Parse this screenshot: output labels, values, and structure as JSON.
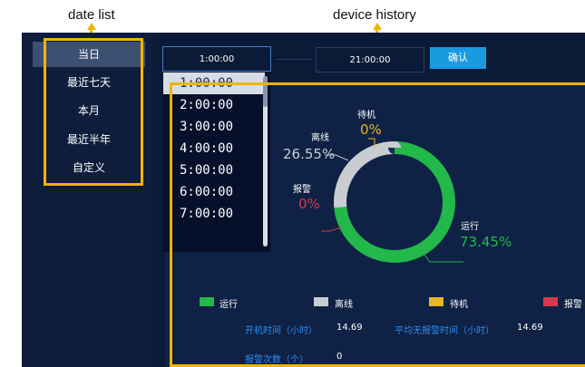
{
  "annotations": {
    "date_list": "date list",
    "device_history": "device history"
  },
  "sidebar": {
    "items": [
      {
        "label": "当日",
        "active": true
      },
      {
        "label": "最近七天"
      },
      {
        "label": "本月"
      },
      {
        "label": "最近半年"
      },
      {
        "label": "自定义"
      }
    ]
  },
  "toolbar": {
    "start_time": "1:00:00",
    "end_time": "21:00:00",
    "confirm_label": "确认"
  },
  "time_dropdown": {
    "options": [
      "1:00:00",
      "2:00:00",
      "3:00:00",
      "4:00:00",
      "5:00:00",
      "6:00:00",
      "7:00:00"
    ],
    "selected": "1:00:00"
  },
  "chart_data": {
    "type": "pie",
    "donut": true,
    "slices": [
      {
        "name": "运行",
        "value": 73.45,
        "label": "73.45%",
        "color": "#22b84a"
      },
      {
        "name": "离线",
        "value": 26.55,
        "label": "26.55%",
        "color": "#c9cdd1"
      },
      {
        "name": "待机",
        "value": 0,
        "label": "0%",
        "color": "#e7b52a"
      },
      {
        "name": "报警",
        "value": 0,
        "label": "0%",
        "color": "#d43a4a"
      }
    ],
    "legend": [
      "运行",
      "离线",
      "待机",
      "报警"
    ],
    "legend_position": "bottom"
  },
  "stats": {
    "run_time_label": "开机时间（小时）",
    "run_time_value": "14.69",
    "mtbf_label": "平均无报警时间（小时）",
    "mtbf_value": "14.69",
    "alarm_count_label": "报警次数（个）",
    "alarm_count_value": "0"
  }
}
